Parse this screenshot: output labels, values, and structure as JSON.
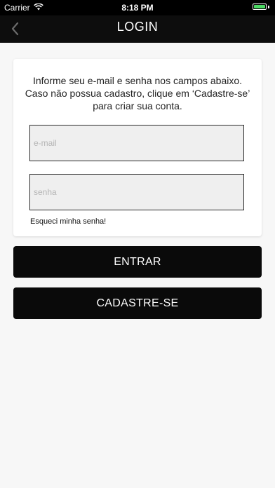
{
  "status_bar": {
    "carrier": "Carrier",
    "time": "8:18 PM",
    "battery_color": "#4cd964"
  },
  "nav": {
    "title": "LOGIN",
    "back_icon": "chevron-left-icon"
  },
  "login_card": {
    "instructions": "Informe seu e-mail e senha nos campos abaixo. Caso não possua cadastro, clique em ‘Cadastre-se’ para criar sua conta.",
    "email_placeholder": "e-mail",
    "email_value": "",
    "password_placeholder": "senha",
    "password_value": "",
    "forgot_password_label": "Esqueci minha senha!"
  },
  "actions": {
    "login_label": "ENTRAR",
    "signup_label": "CADASTRE-SE"
  }
}
